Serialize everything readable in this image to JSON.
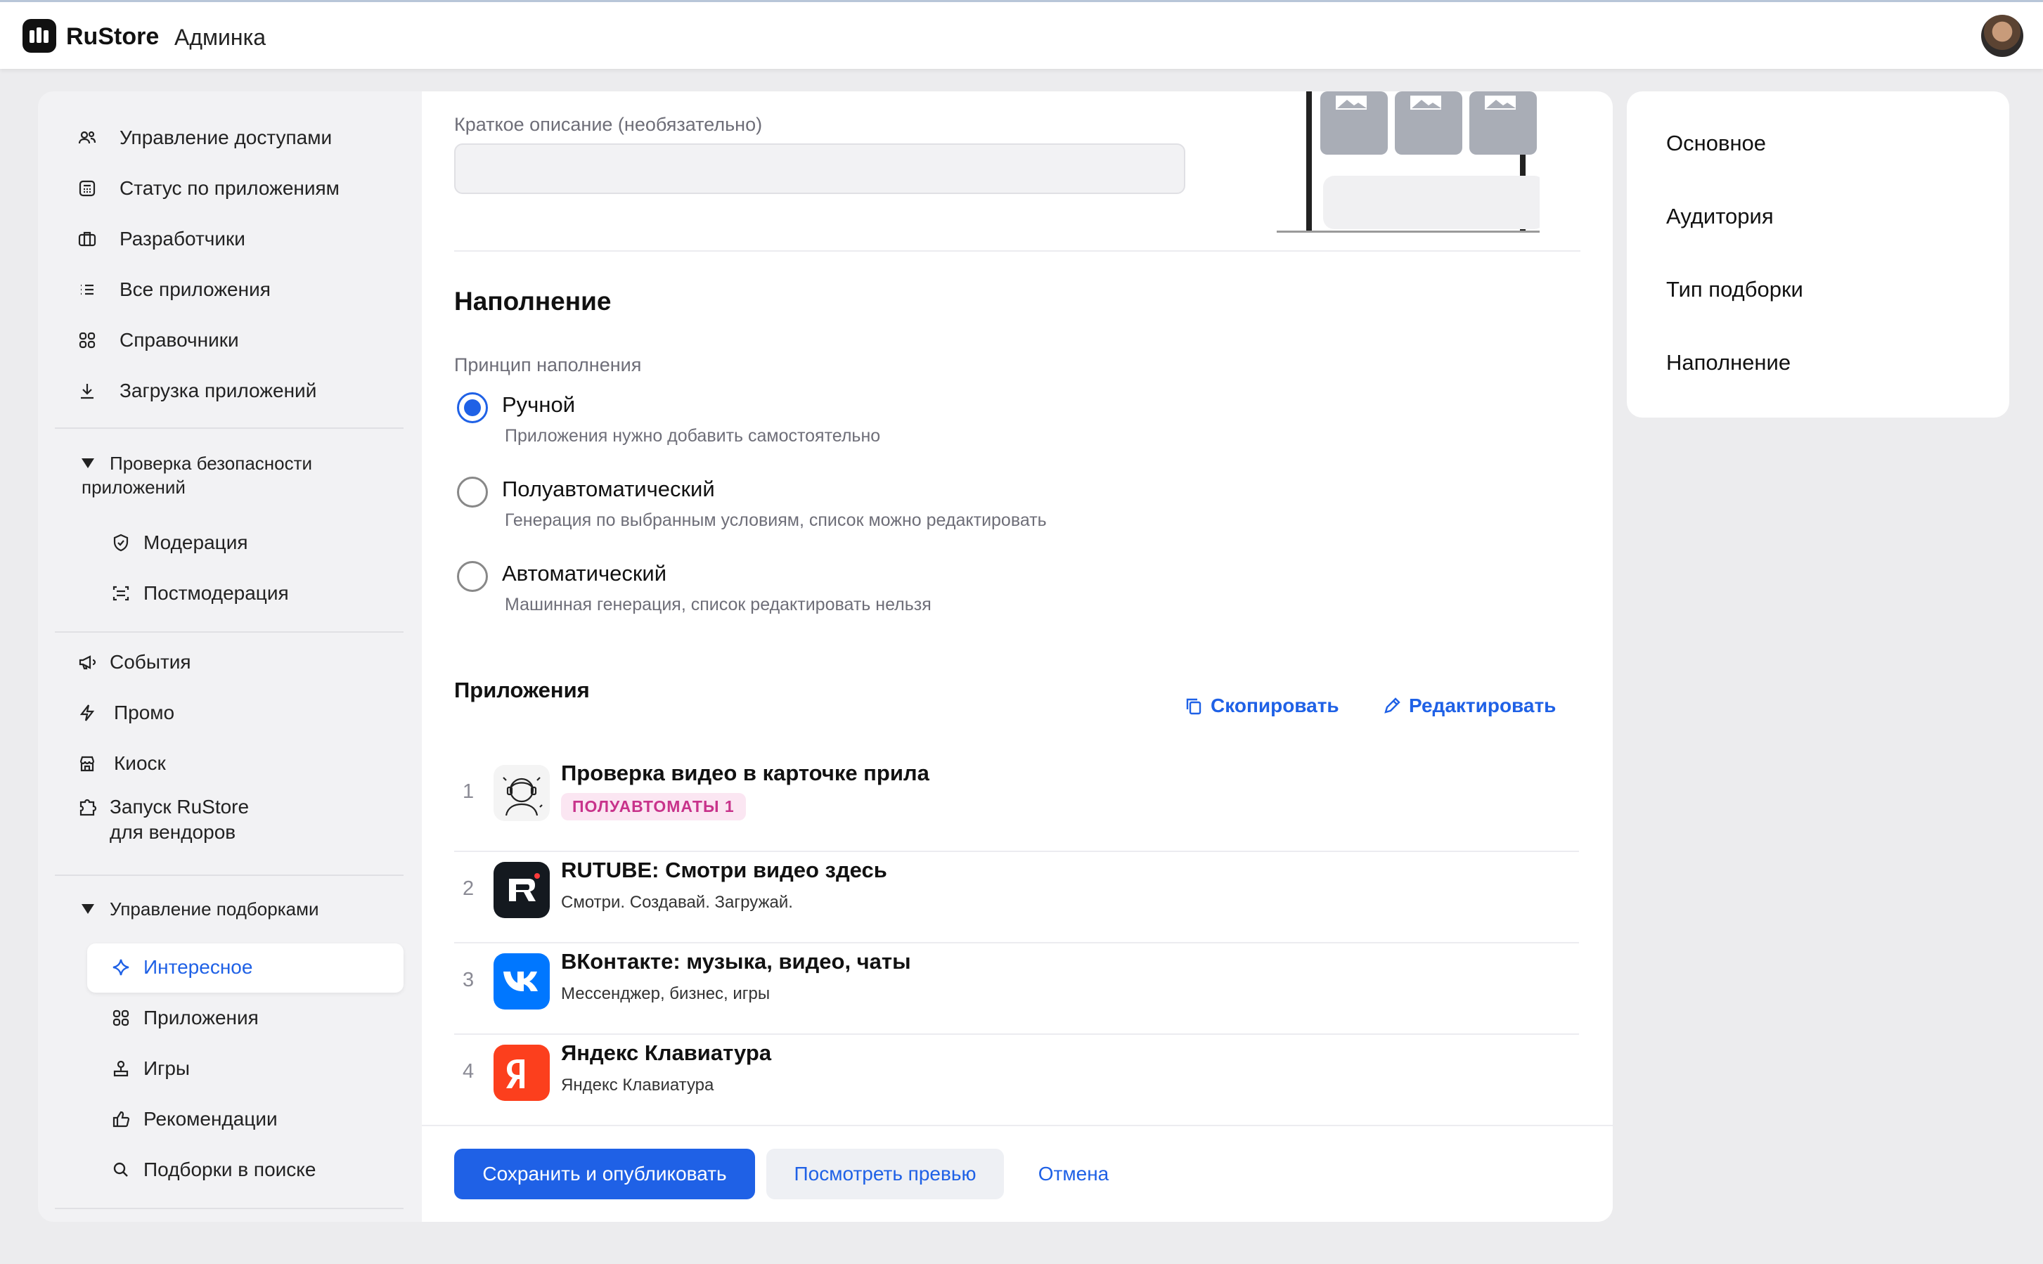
{
  "header": {
    "brand": "RuStore",
    "section": "Админка"
  },
  "sidebar": {
    "items": [
      {
        "label": "Управление доступами"
      },
      {
        "label": "Статус по приложениям"
      },
      {
        "label": "Разработчики"
      },
      {
        "label": "Все приложения"
      },
      {
        "label": "Справочники"
      },
      {
        "label": "Загрузка приложений"
      }
    ],
    "security_group": {
      "title": "Проверка безопасности приложений",
      "items": [
        {
          "label": "Модерация"
        },
        {
          "label": "Постмодерация"
        }
      ]
    },
    "items2": [
      {
        "label": "События"
      },
      {
        "label": "Промо"
      },
      {
        "label": "Киоск"
      },
      {
        "label": "Запуск RuStore для вендоров"
      }
    ],
    "collections_group": {
      "title": "Управление подборками",
      "items": [
        {
          "label": "Интересное"
        },
        {
          "label": "Приложения"
        },
        {
          "label": "Игры"
        },
        {
          "label": "Рекомендации"
        },
        {
          "label": "Подборки в поиске"
        }
      ]
    }
  },
  "main": {
    "short_desc_label": "Краткое описание (необязательно)",
    "short_desc_value": "",
    "fill_section_title": "Наполнение",
    "fill_principle_label": "Принцип наполнения",
    "fill_options": [
      {
        "label": "Ручной",
        "hint": "Приложения нужно добавить самостоятельно",
        "checked": true
      },
      {
        "label": "Полуавтоматический",
        "hint": "Генерация по выбранным условиям, список можно редактировать",
        "checked": false
      },
      {
        "label": "Автоматический",
        "hint": "Машинная генерация, список редактировать нельзя",
        "checked": false
      }
    ],
    "apps_title": "Приложения",
    "copy_label": "Скопировать",
    "edit_label": "Редактировать",
    "apps": [
      {
        "num": "1",
        "title": "Проверка видео в карточке прила",
        "badge": "ПОЛУАВТОМАТЫ 1"
      },
      {
        "num": "2",
        "title": "RUTUBE: Смотри видео здесь",
        "subtitle": "Смотри. Создавай. Загружай."
      },
      {
        "num": "3",
        "title": "ВКонтакте: музыка, видео, чаты",
        "subtitle": "Мессенджер, бизнес, игры"
      },
      {
        "num": "4",
        "title": "Яндекс Клавиатура",
        "subtitle": "Яндекс Клавиатура"
      }
    ]
  },
  "footer": {
    "publish_label": "Сохранить и опубликовать",
    "preview_label": "Посмотреть превью",
    "cancel_label": "Отмена"
  },
  "right_nav": {
    "items": [
      {
        "label": "Основное"
      },
      {
        "label": "Аудитория"
      },
      {
        "label": "Тип подборки"
      },
      {
        "label": "Наполнение"
      }
    ]
  },
  "colors": {
    "accent": "#1f61e6",
    "badge_text": "#c8338b",
    "badge_bg": "#fbe6f2",
    "rutube": "#14191f",
    "vk": "#0077ff",
    "yandex": "#fc3f1d"
  },
  "icons": {
    "brand": "rustore-logo-icon",
    "users": "users-icon",
    "status": "calculator-icon",
    "developers": "briefcase-icon",
    "all_apps": "list-icon",
    "dictionaries": "grid-icon",
    "upload": "download-icon",
    "moderation": "shield-check-icon",
    "postmoderation": "scan-icon",
    "events": "megaphone-icon",
    "promo": "lightning-icon",
    "kiosk": "store-icon",
    "vendors": "puzzle-icon",
    "interesting": "sparkle-icon",
    "apps": "grid-icon",
    "games": "joystick-icon",
    "recommendations": "thumbs-up-icon",
    "search_collections": "search-icon",
    "copy": "copy-icon",
    "edit": "pencil-icon"
  }
}
